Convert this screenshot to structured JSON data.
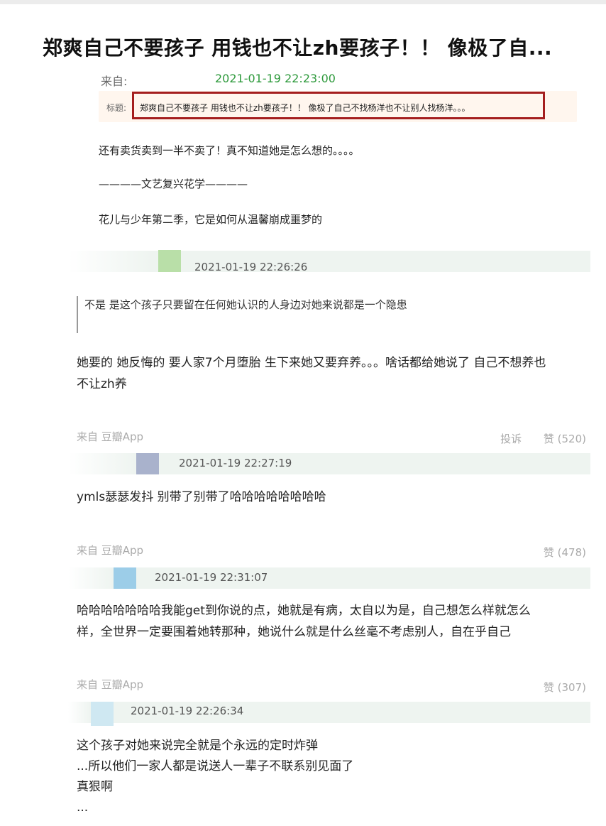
{
  "post": {
    "title": "郑爽自己不要孩子 用钱也不让zh要孩子！！ 像极了自...",
    "from_label": "来自:",
    "timestamp": "2021-01-19 22:23:00",
    "topic_label": "标题:",
    "topic_text": "郑爽自己不要孩子 用钱也不让zh要孩子！！ 像极了自己不找杨洋也不让别人找杨洋。。。",
    "body": [
      "还有卖货卖到一半不卖了！真不知道她是怎么想的。。。。",
      "————文艺复兴花学————",
      "花儿与少年第二季，它是如何从温馨崩成噩梦的"
    ]
  },
  "comments": [
    {
      "time": "2021-01-19 22:26:26",
      "avatar_color": "#b9dfa8",
      "quote": "不是 是这个孩子只要留在任何她认识的人身边对她来说都是一个隐患",
      "lines": [
        "她要的 她反悔的 要人家7个月堕胎 生下来她又要弃养。。。啥话都给她说了 自己不想养也",
        "不让zh养"
      ],
      "source": "来自 豆瓣App",
      "report": "投诉",
      "likes": "赞 (520)"
    },
    {
      "time": "2021-01-19 22:27:19",
      "avatar_color": "#a9b2cc",
      "lines": [
        "ymls瑟瑟发抖 别带了别带了哈哈哈哈哈哈哈哈"
      ],
      "source": "来自 豆瓣App",
      "likes": "赞 (478)"
    },
    {
      "time": "2021-01-19 22:31:07",
      "avatar_color": "#9ccde8",
      "lines": [
        "哈哈哈哈哈哈哈我能get到你说的点，她就是有病，太自以为是，自己想怎么样就怎么",
        "样，全世界一定要围着她转那种，她说什么就是什么丝毫不考虑别人，自在乎自己"
      ],
      "source": "来自 豆瓣App",
      "likes": "赞 (307)"
    },
    {
      "time": "2021-01-19 22:26:34",
      "avatar_color": "#cfe8f2",
      "lines": [
        "这个孩子对她来说完全就是个永远的定时炸弹",
        "...所以他们一家人都是说送人一辈子不联系别见面了",
        "真狠啊",
        "..."
      ]
    }
  ]
}
